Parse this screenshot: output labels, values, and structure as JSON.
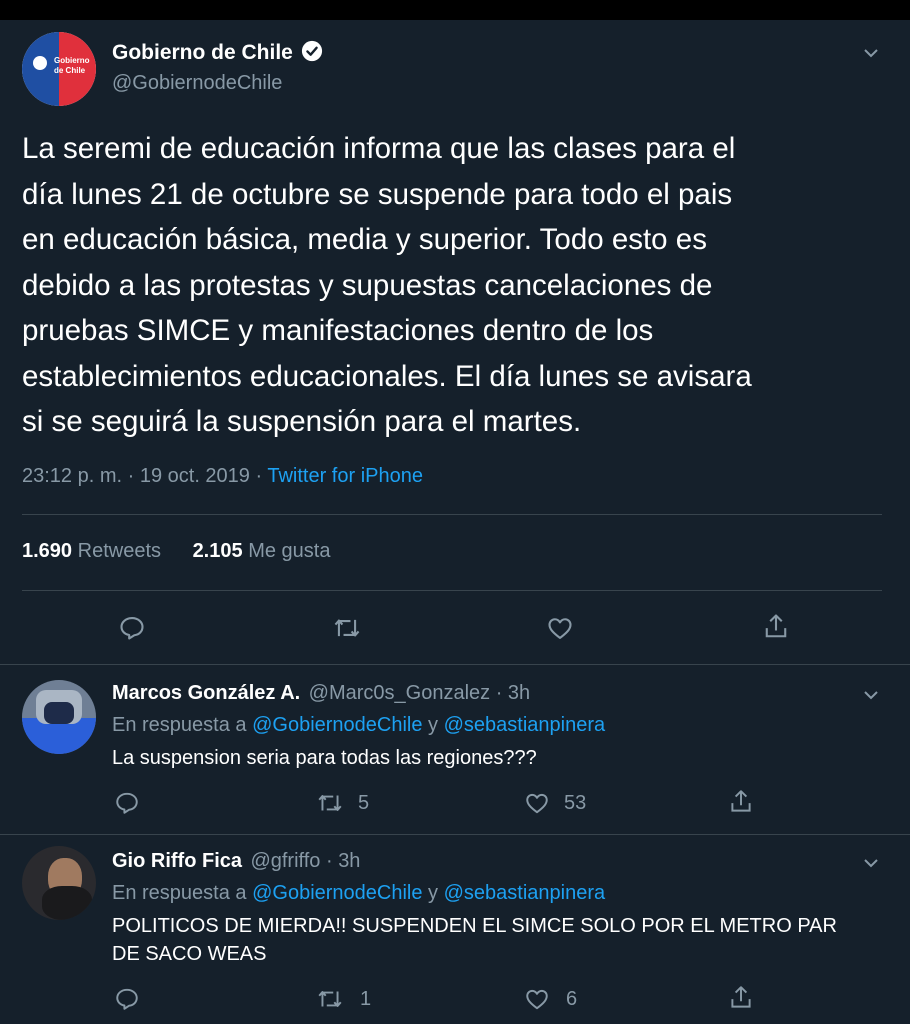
{
  "colors": {
    "background": "#15202b",
    "muted": "#8899a6",
    "link": "#1da1f2",
    "divider": "#38444d",
    "verified": "#ffffff"
  },
  "tweet": {
    "avatar_text": [
      "Gobierno",
      "de Chile"
    ],
    "author_name": "Gobierno de Chile",
    "author_handle": "@GobiernodeChile",
    "body_lines": [
      "La seremi de educación informa que las clases para el",
      "día lunes 21 de octubre se suspende para todo el pais",
      "en educación básica, media y superior. Todo esto es",
      "debido a las protestas y supuestas cancelaciones de",
      "pruebas SIMCE y manifestaciones dentro de los",
      "establecimientos educacionales. El día lunes se avisara",
      "si se seguirá la suspensión para el martes."
    ],
    "timestamp": "23:12 p. m. · 19 oct. 2019 · ",
    "source": "Twitter for iPhone",
    "retweets_count": "1.690",
    "retweets_label": "Retweets",
    "likes_count": "2.105",
    "likes_label": "Me gusta",
    "actions": [
      "reply-icon",
      "retweet-icon",
      "like-icon",
      "share-icon"
    ]
  },
  "replies": [
    {
      "name": "Marcos González A.",
      "handle_time": "@Marc0s_Gonzalez · 3h",
      "reply_prefix": "En respuesta a ",
      "mention1": "@GobiernodeChile",
      "connector": " y ",
      "mention2": "@sebastianpinera",
      "text": "La suspension seria para todas las regiones???",
      "retweets": "5",
      "likes": "53"
    },
    {
      "name": "Gio Riffo Fica",
      "handle_time": "@gfriffo · 3h",
      "reply_prefix": "En respuesta a ",
      "mention1": "@GobiernodeChile",
      "connector": " y ",
      "mention2": "@sebastianpinera",
      "text_lines": [
        "POLITICOS DE MIERDA!! SUSPENDEN EL SIMCE SOLO POR EL METRO PAR",
        "DE SACO WEAS"
      ],
      "retweets": "1",
      "likes": "6"
    }
  ]
}
